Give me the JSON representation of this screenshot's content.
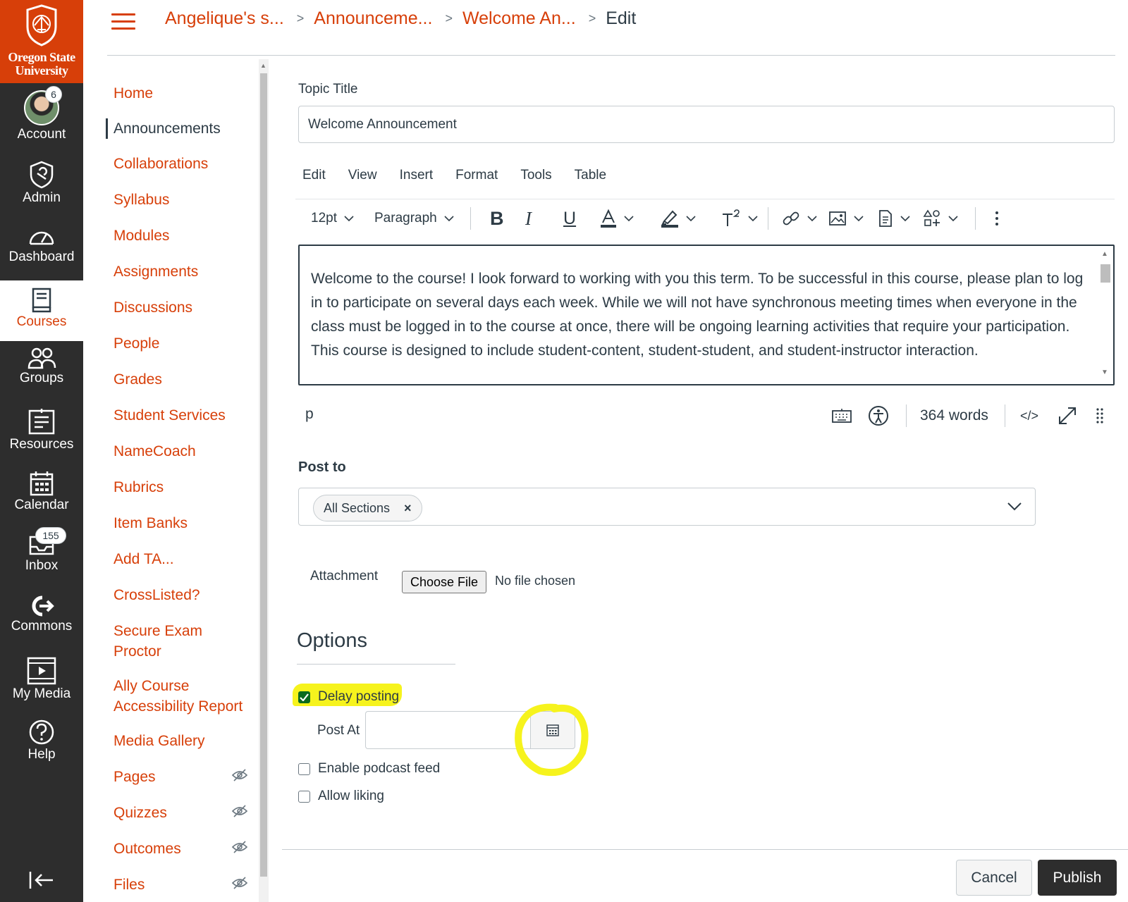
{
  "brand": {
    "name_line1": "Oregon State",
    "name_line2": "University",
    "accent": "#d73f09",
    "nav_bg": "#2d2d2d"
  },
  "global_nav": [
    {
      "label": "Account",
      "icon": "avatar-icon",
      "badge": "6"
    },
    {
      "label": "Admin",
      "icon": "shield-icon"
    },
    {
      "label": "Dashboard",
      "icon": "speedometer-icon"
    },
    {
      "label": "Courses",
      "icon": "book-icon",
      "active": true
    },
    {
      "label": "Groups",
      "icon": "groups-icon"
    },
    {
      "label": "Resources",
      "icon": "clipboard-icon"
    },
    {
      "label": "Calendar",
      "icon": "calendar-icon"
    },
    {
      "label": "Inbox",
      "icon": "inbox-icon",
      "badge": "155"
    },
    {
      "label": "Commons",
      "icon": "commons-icon"
    },
    {
      "label": "My Media",
      "icon": "media-icon"
    },
    {
      "label": "Help",
      "icon": "help-icon"
    }
  ],
  "breadcrumb": {
    "course": "Angelique's s...",
    "section": "Announceme...",
    "page": "Welcome An...",
    "current": "Edit"
  },
  "course_nav": [
    {
      "label": "Home"
    },
    {
      "label": "Announcements",
      "active": true
    },
    {
      "label": "Collaborations"
    },
    {
      "label": "Syllabus"
    },
    {
      "label": "Modules"
    },
    {
      "label": "Assignments"
    },
    {
      "label": "Discussions"
    },
    {
      "label": "People"
    },
    {
      "label": "Grades"
    },
    {
      "label": "Student Services"
    },
    {
      "label": "NameCoach"
    },
    {
      "label": "Rubrics"
    },
    {
      "label": "Item Banks"
    },
    {
      "label": "Add TA..."
    },
    {
      "label": "CrossListed?"
    },
    {
      "label": "Secure Exam Proctor"
    },
    {
      "label": "Ally Course Accessibility Report"
    },
    {
      "label": "Media Gallery"
    },
    {
      "label": "Pages",
      "hidden": true
    },
    {
      "label": "Quizzes",
      "hidden": true
    },
    {
      "label": "Outcomes",
      "hidden": true
    },
    {
      "label": "Files",
      "hidden": true
    }
  ],
  "form": {
    "topic_title_label": "Topic Title",
    "topic_title_value": "Welcome Announcement",
    "menubar": [
      "Edit",
      "View",
      "Insert",
      "Format",
      "Tools",
      "Table"
    ],
    "toolbar": {
      "font_size": "12pt",
      "block_format": "Paragraph"
    },
    "body_text": "Welcome to the course! I look forward to working with you this term. To be successful in this course, please plan to log in to participate on several days each week. While we will not have synchronous meeting times when everyone in the class must be logged in to the course at once, there will be ongoing learning activities that require your participation. This course is designed to include student-content, student-student, and student-instructor interaction.",
    "status_path": "p",
    "word_count": "364 words",
    "post_to_label": "Post to",
    "post_to_chip": "All Sections",
    "attachment_label": "Attachment",
    "choose_file": "Choose File",
    "no_file": "No file chosen",
    "options_title": "Options",
    "delay_posting": "Delay posting",
    "delay_posting_checked": true,
    "post_at_label": "Post At",
    "post_at_value": "",
    "podcast": "Enable podcast feed",
    "liking": "Allow liking",
    "cancel": "Cancel",
    "publish": "Publish"
  }
}
